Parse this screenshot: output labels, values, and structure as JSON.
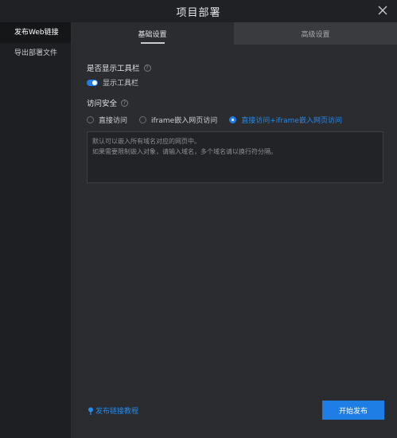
{
  "dialog": {
    "title": "项目部署",
    "close_icon": "close-icon"
  },
  "sidebar": {
    "items": [
      {
        "label": "发布Web链接",
        "active": true
      },
      {
        "label": "导出部署文件",
        "active": false
      }
    ]
  },
  "tabs": [
    {
      "label": "基础设置",
      "active": true
    },
    {
      "label": "高级设置",
      "active": false
    }
  ],
  "toolbar_section": {
    "title": "是否显示工具栏",
    "help": "?",
    "toggle_label": "显示工具栏",
    "toggle_on": true
  },
  "access_section": {
    "title": "访问安全",
    "help": "?",
    "options": [
      {
        "label": "直接访问",
        "checked": false
      },
      {
        "label": "iframe嵌入网页访问",
        "checked": false
      },
      {
        "label": "直接访问+iframe嵌入网页访问",
        "checked": true
      }
    ],
    "domain_placeholder_line1": "默认可以嵌入所有域名对应的网页中。",
    "domain_placeholder_line2": "如果需要限制嵌入对象，请输入域名，多个域名请以换行符分隔。"
  },
  "footer": {
    "help_link": "发布链接教程",
    "start_button": "开始发布"
  },
  "colors": {
    "accent": "#1f7ee6",
    "link": "#1f8cf0",
    "background": "#2b2c30",
    "sidebar": "#1e1f22"
  }
}
